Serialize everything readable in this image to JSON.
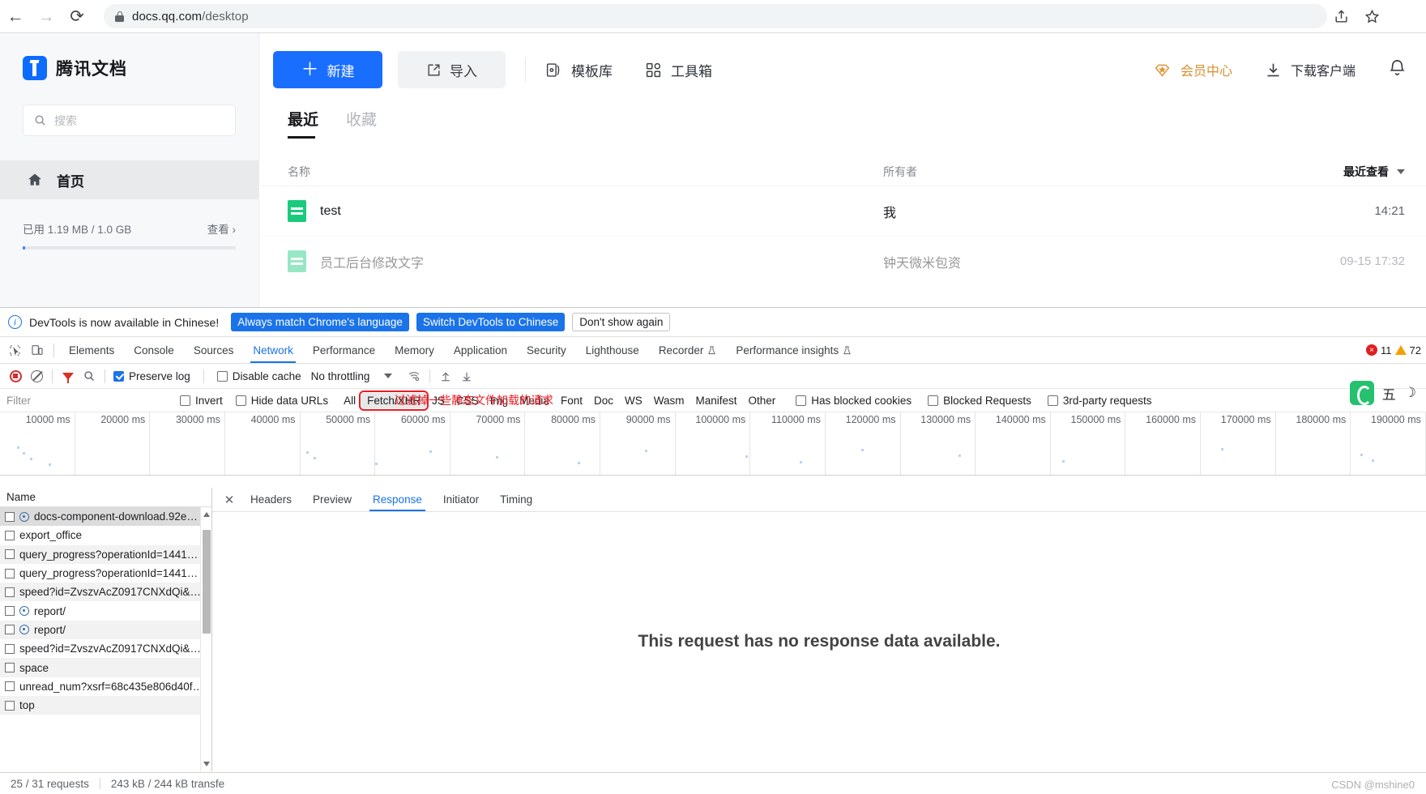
{
  "browser": {
    "back_icon": "back-arrow-icon",
    "forward_icon": "forward-arrow-icon",
    "reload_icon": "reload-icon",
    "url_host": "docs.qq.com",
    "url_path": "/desktop",
    "share_icon": "share-icon",
    "bookmark_icon": "star-icon"
  },
  "app": {
    "brand": "腾讯文档",
    "search": {
      "placeholder": "搜索"
    },
    "sidebar": {
      "items": [
        {
          "label": "首页",
          "icon": "home-icon"
        }
      ],
      "storage_text": "已用 1.19 MB / 1.0 GB",
      "storage_view": "查看 ›"
    },
    "toolbar": {
      "new_label": "新建",
      "import_label": "导入",
      "template_label": "模板库",
      "toolbox_label": "工具箱",
      "vip_label": "会员中心",
      "download_label": "下载客户端",
      "bell_icon": "bell-icon"
    },
    "tabs": [
      {
        "label": "最近",
        "active": true
      },
      {
        "label": "收藏",
        "active": false
      }
    ],
    "table": {
      "columns": {
        "name": "名称",
        "owner": "所有者",
        "date": "最近查看"
      },
      "rows": [
        {
          "name": "test",
          "owner": "我",
          "date": "14:21"
        },
        {
          "name": "员工后台修改文字",
          "owner": "钟天微米包资",
          "date": "09-15 17:32"
        }
      ]
    }
  },
  "devtools": {
    "banner": {
      "message": "DevTools is now available in Chinese!",
      "btn_always": "Always match Chrome's language",
      "btn_switch": "Switch DevTools to Chinese",
      "btn_dismiss": "Don't show again",
      "info_icon": "info-icon"
    },
    "main_tabs": [
      {
        "label": "Elements",
        "active": false
      },
      {
        "label": "Console",
        "active": false
      },
      {
        "label": "Sources",
        "active": false
      },
      {
        "label": "Network",
        "active": true
      },
      {
        "label": "Performance",
        "active": false
      },
      {
        "label": "Memory",
        "active": false
      },
      {
        "label": "Application",
        "active": false
      },
      {
        "label": "Security",
        "active": false
      },
      {
        "label": "Lighthouse",
        "active": false
      },
      {
        "label": "Recorder",
        "active": false,
        "flask": true
      },
      {
        "label": "Performance insights",
        "active": false,
        "flask": true
      }
    ],
    "counters": {
      "errors": "11",
      "warnings": "72"
    },
    "network_toolbar": {
      "record_icon": "record-stop-icon",
      "clear_icon": "clear-icon",
      "filter_icon": "funnel-icon",
      "search_icon": "search-icon",
      "preserve_log": "Preserve log",
      "disable_cache": "Disable cache",
      "throttling": "No throttling",
      "wifi_icon": "network-conditions-icon",
      "import_icon": "import-har-icon",
      "export_icon": "export-har-icon"
    },
    "filter_bar": {
      "placeholder": "Filter",
      "invert": "Invert",
      "hide_data_urls": "Hide data URLs",
      "types": [
        "All",
        "Fetch/XHR",
        "JS",
        "CSS",
        "Img",
        "Media",
        "Font",
        "Doc",
        "WS",
        "Wasm",
        "Manifest",
        "Other"
      ],
      "selected_type": "Fetch/XHR",
      "has_blocked_cookies": "Has blocked cookies",
      "blocked_requests": "Blocked Requests",
      "third_party": "3rd-party requests"
    },
    "annotation": "过滤掉一些静态文件加载的请求",
    "overview_ticks": [
      "10000 ms",
      "20000 ms",
      "30000 ms",
      "40000 ms",
      "50000 ms",
      "60000 ms",
      "70000 ms",
      "80000 ms",
      "90000 ms",
      "100000 ms",
      "110000 ms",
      "120000 ms",
      "130000 ms",
      "140000 ms",
      "150000 ms",
      "160000 ms",
      "170000 ms",
      "180000 ms",
      "190000 ms"
    ],
    "request_list": {
      "header": "Name",
      "rows": [
        {
          "name": "docs-component-download.92e…",
          "gear": true,
          "selected": true
        },
        {
          "name": "export_office",
          "gear": false,
          "selected": false
        },
        {
          "name": "query_progress?operationId=1441…",
          "gear": false,
          "selected": false
        },
        {
          "name": "query_progress?operationId=1441…",
          "gear": false,
          "selected": false
        },
        {
          "name": "speed?id=ZvszvAcZ0917CNXdQi&…",
          "gear": false,
          "selected": false
        },
        {
          "name": "report/",
          "gear": true,
          "selected": false
        },
        {
          "name": "report/",
          "gear": true,
          "selected": false
        },
        {
          "name": "speed?id=ZvszvAcZ0917CNXdQi&…",
          "gear": false,
          "selected": false
        },
        {
          "name": "space",
          "gear": false,
          "selected": false
        },
        {
          "name": "unread_num?xsrf=68c435e806d40f…",
          "gear": false,
          "selected": false
        },
        {
          "name": "top",
          "gear": false,
          "selected": false
        }
      ]
    },
    "detail_tabs": [
      {
        "label": "Headers",
        "active": false
      },
      {
        "label": "Preview",
        "active": false
      },
      {
        "label": "Response",
        "active": true
      },
      {
        "label": "Initiator",
        "active": false
      },
      {
        "label": "Timing",
        "active": false
      }
    ],
    "detail_message": "This request has no response data available.",
    "status_bar": {
      "requests": "25 / 31 requests",
      "transferred": "243 kB / 244 kB transfe"
    }
  },
  "overlays": {
    "sogou_label": "五",
    "watermark": "CSDN @mshine0"
  }
}
